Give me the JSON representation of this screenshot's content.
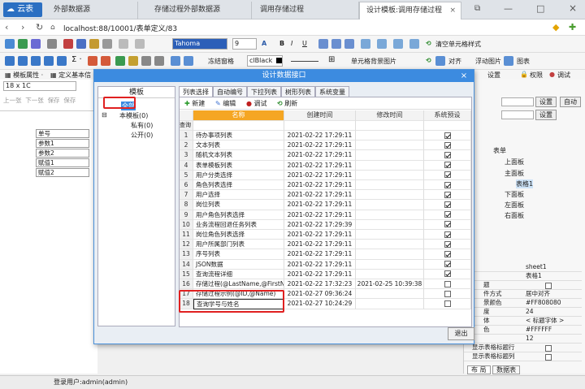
{
  "app": {
    "logo": "云表"
  },
  "tabs": [
    {
      "label": "外部数据源"
    },
    {
      "label": "存储过程外部数据源"
    },
    {
      "label": "调用存储过程"
    },
    {
      "label": "设计模板:调用存储过程",
      "active": true
    }
  ],
  "address": {
    "url": "localhost:88/10001/表单定义/83"
  },
  "toolbar1": {
    "font_name": "Tahoma",
    "font_size": "9",
    "clear_fmt": "清空单元格样式"
  },
  "toolbar2": {
    "freeze": "冻结窗格",
    "color_name": "clBlack",
    "cell_image": "单元格背景图片",
    "align": "对齐",
    "float_img": "浮动图片",
    "chart": "图表",
    "settings": "设置",
    "rights": "权限",
    "debug": "调试"
  },
  "toolbar3": {
    "template_props": "模板属性",
    "define_basic": "定义基本信"
  },
  "cellref": "18 x 1C",
  "left_toolbar": [
    "上一张",
    "下一张",
    "保存",
    "保存"
  ],
  "sheet_cells": [
    "单号",
    "参数1",
    "参数2",
    "赋值1",
    "赋值2"
  ],
  "right_panel": {
    "set1": "设置",
    "set2": "设置",
    "auto": "自动",
    "tree": [
      "表单",
      "上面板",
      "主面板",
      "表格1",
      "下面板",
      "左面板",
      "右面板"
    ],
    "props": [
      {
        "k": "",
        "v": "sheet1"
      },
      {
        "k": "",
        "v": "表格1"
      },
      {
        "k": "题",
        "v": ""
      },
      {
        "k": "件方式",
        "v": "居中对齐"
      },
      {
        "k": "景颜色",
        "v": "#FF808080"
      },
      {
        "k": "度",
        "v": "24"
      },
      {
        "k": "体",
        "v": "< 标题字体 >"
      },
      {
        "k": "色",
        "v": "#FFFFFF"
      },
      {
        "k": "",
        "v": "12"
      },
      {
        "k": "显示表格标题行",
        "v": ""
      },
      {
        "k": "显示表格标题列",
        "v": ""
      }
    ],
    "bottom_tabs": [
      "布 局",
      "数据表"
    ]
  },
  "status": {
    "user": "登录用户:admin(admin)"
  },
  "dialog": {
    "title": "设计数据接口",
    "tree_header": "模板",
    "tree": [
      {
        "label": "全部"
      },
      {
        "label": "本模板(0)"
      },
      {
        "label": "私有(0)"
      },
      {
        "label": "公开(0)"
      }
    ],
    "tabs": [
      "列表选择",
      "自动编号",
      "下拉列表",
      "树形列表",
      "系统变量"
    ],
    "buttons": {
      "new": "新建",
      "edit": "编辑",
      "debug": "调试",
      "refresh": "刷新"
    },
    "columns": {
      "name": "名称",
      "created": "创建时间",
      "modified": "修改时间",
      "sys": "系统预设"
    },
    "query_label": "查询",
    "rows": [
      {
        "n": "1",
        "name": "待办事项列表",
        "c": "2021-02-22 17:29:11",
        "m": "",
        "sys": true
      },
      {
        "n": "2",
        "name": "文本列表",
        "c": "2021-02-22 17:29:11",
        "m": "",
        "sys": true
      },
      {
        "n": "3",
        "name": "随机文本列表",
        "c": "2021-02-22 17:29:11",
        "m": "",
        "sys": true
      },
      {
        "n": "4",
        "name": "表单模板列表",
        "c": "2021-02-22 17:29:11",
        "m": "",
        "sys": true
      },
      {
        "n": "5",
        "name": "用户分类选择",
        "c": "2021-02-22 17:29:11",
        "m": "",
        "sys": true
      },
      {
        "n": "6",
        "name": "角色列表选择",
        "c": "2021-02-22 17:29:11",
        "m": "",
        "sys": true
      },
      {
        "n": "7",
        "name": "用户选择",
        "c": "2021-02-22 17:29:11",
        "m": "",
        "sys": true
      },
      {
        "n": "8",
        "name": "岗位列表",
        "c": "2021-02-22 17:29:11",
        "m": "",
        "sys": true
      },
      {
        "n": "9",
        "name": "用户角色列表选择",
        "c": "2021-02-22 17:29:11",
        "m": "",
        "sys": true
      },
      {
        "n": "10",
        "name": "业务流程回退任务列表",
        "c": "2021-02-22 17:29:39",
        "m": "",
        "sys": true
      },
      {
        "n": "11",
        "name": "岗位角色列表选择",
        "c": "2021-02-22 17:29:11",
        "m": "",
        "sys": true
      },
      {
        "n": "12",
        "name": "用户所属部门列表",
        "c": "2021-02-22 17:29:11",
        "m": "",
        "sys": true
      },
      {
        "n": "13",
        "name": "序号列表",
        "c": "2021-02-22 17:29:11",
        "m": "",
        "sys": true
      },
      {
        "n": "14",
        "name": "JSON数据",
        "c": "2021-02-22 17:29:11",
        "m": "",
        "sys": true
      },
      {
        "n": "15",
        "name": "查询流程详细",
        "c": "2021-02-22 17:29:11",
        "m": "",
        "sys": true
      },
      {
        "n": "16",
        "name": "存储过程(@LastName,@FirstN",
        "c": "2021-02-22 17:32:23",
        "m": "2021-02-25 10:39:38",
        "sys": false
      },
      {
        "n": "17",
        "name": "存储过程示例(@ID,@Name)",
        "c": "2021-02-27 09:36:24",
        "m": "",
        "sys": false
      },
      {
        "n": "18",
        "name": "查询学号与姓名",
        "c": "2021-02-27 10:24:29",
        "m": "",
        "sys": false
      }
    ],
    "exit": "退出"
  }
}
